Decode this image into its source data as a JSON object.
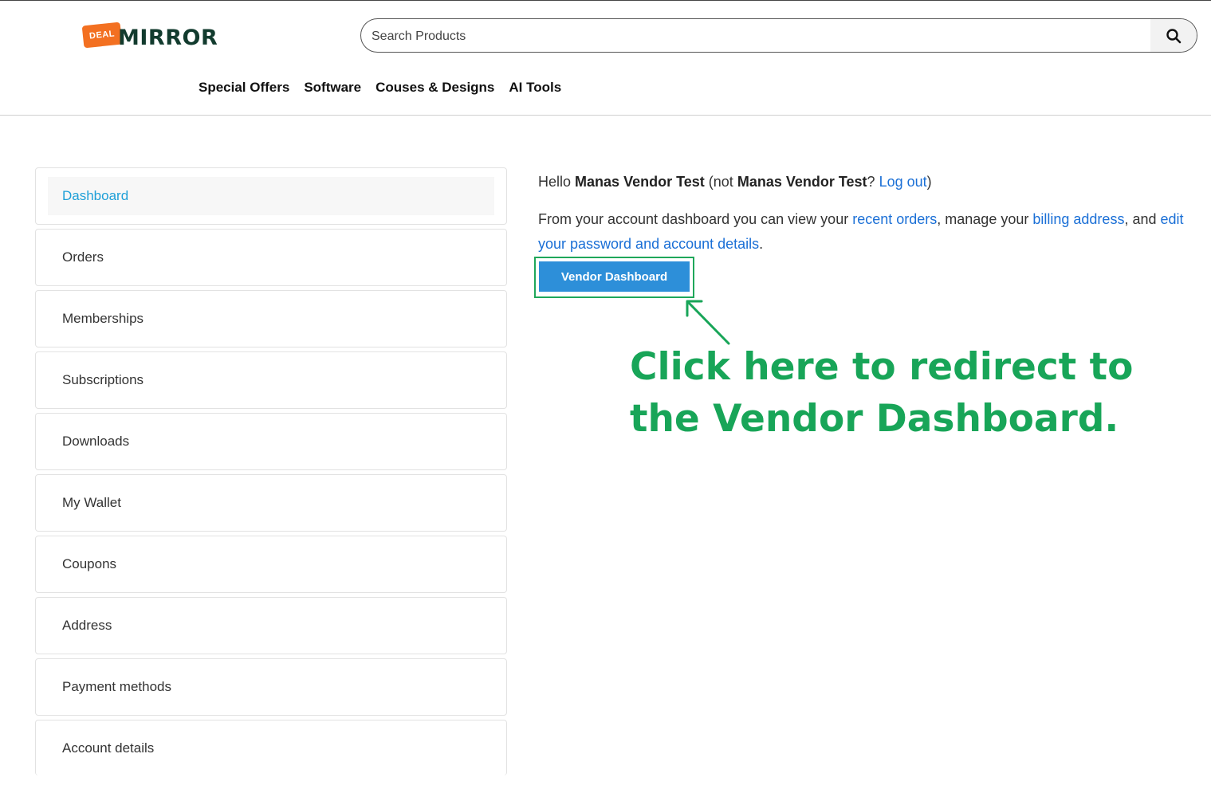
{
  "header": {
    "logo": {
      "tag": "DEAL",
      "word": "MIRROR"
    },
    "search": {
      "placeholder": "Search Products",
      "icon": "search-icon"
    },
    "nav": [
      "Special Offers",
      "Software",
      "Couses & Designs",
      "AI Tools"
    ]
  },
  "sidebar": {
    "items": [
      {
        "label": "Dashboard",
        "active": true
      },
      {
        "label": "Orders"
      },
      {
        "label": "Memberships"
      },
      {
        "label": "Subscriptions"
      },
      {
        "label": "Downloads"
      },
      {
        "label": "My Wallet"
      },
      {
        "label": "Coupons"
      },
      {
        "label": "Address"
      },
      {
        "label": "Payment methods"
      },
      {
        "label": "Account details"
      }
    ]
  },
  "main": {
    "hello": "Hello",
    "username": "Manas Vendor Test",
    "not_prefix": "(not",
    "username_again": "Manas Vendor Test",
    "question": "?",
    "logout": "Log out",
    "close_paren": ")",
    "intro_1": "From your account dashboard you can view your",
    "recent_orders": "recent orders",
    "intro_2": ", manage your",
    "billing_address": "billing address",
    "intro_3": ", and",
    "edit_details": "edit your password and account details",
    "intro_4": ".",
    "vendor_button": "Vendor Dashboard"
  },
  "annotation": {
    "line1": "Click here to redirect to",
    "line2": "the Vendor Dashboard."
  },
  "colors": {
    "accent_green": "#18a558",
    "link_blue": "#1a6fd6",
    "button_blue": "#2d8fd9",
    "active_item": "#1fa0d8",
    "logo_orange": "#f37021"
  }
}
